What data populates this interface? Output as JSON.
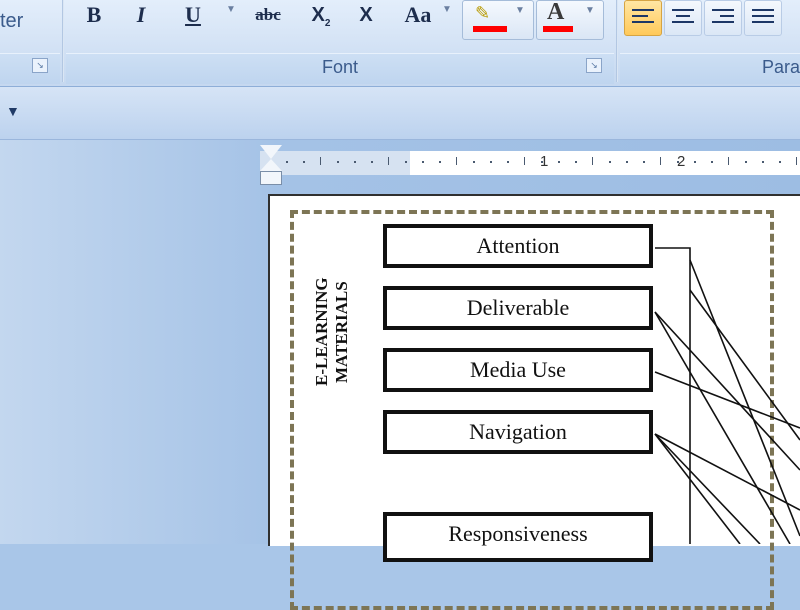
{
  "ribbon": {
    "clipboard_partial_label": "ter",
    "font_group": {
      "label": "Font",
      "bold": "B",
      "italic": "I",
      "underline": "U",
      "strikethrough": "abc",
      "subscript": "X",
      "clear": "X",
      "change_case": "Aa",
      "highlight_color": "#ff0000",
      "font_color": "#ff0000"
    },
    "paragraph_partial_label": "Para"
  },
  "document": {
    "ruler_numbers": [
      "1",
      "2"
    ],
    "diagram": {
      "side_label": "E-LEARNING MATERIALS",
      "boxes": [
        "Attention",
        "Deliverable",
        "Media Use",
        "Navigation",
        "Responsiveness"
      ]
    }
  }
}
